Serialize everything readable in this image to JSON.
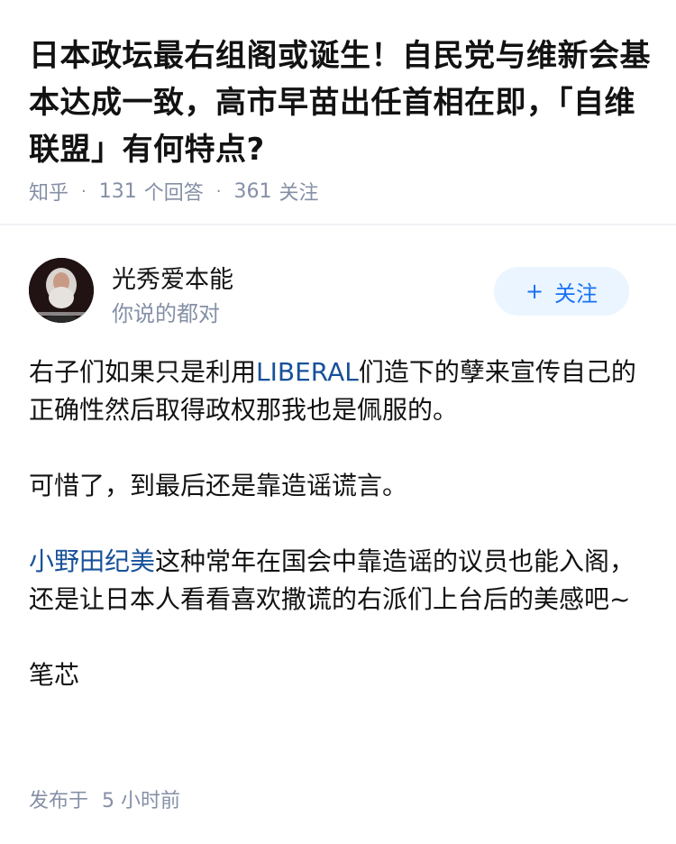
{
  "question": {
    "title": "日本政坛最右组阁或诞生！自民党与维新会基本达成一致，高市早苗出任首相在即，「自维联盟」有何特点?",
    "source": "知乎",
    "answers_count": "131",
    "answers_label": "个回答",
    "followers_count": "361",
    "followers_label": "关注"
  },
  "author": {
    "name": "光秀爱本能",
    "bio": "你说的都对",
    "follow_label": "关注",
    "follow_icon": "plus-icon"
  },
  "answer": {
    "p1_pre": "右子们如果只是利用",
    "p1_link": "LIBERAL",
    "p1_post": "们造下的孽来宣传自己的正确性然后取得政权那我也是佩服的。",
    "p2": "可惜了，到最后还是靠造谣谎言。",
    "p3_link": "小野田纪美",
    "p3_post": "这种常年在国会中靠造谣的议员也能入阁，还是让日本人看看喜欢撒谎的右派们上台后的美感吧~",
    "p4": "笔芯"
  },
  "footer": {
    "published_label": "发布于",
    "time_value": "5 小时前"
  },
  "colors": {
    "link": "#175199",
    "meta": "#8590a6",
    "follow_bg": "#ebf5ff",
    "follow_text": "#1772f6"
  }
}
